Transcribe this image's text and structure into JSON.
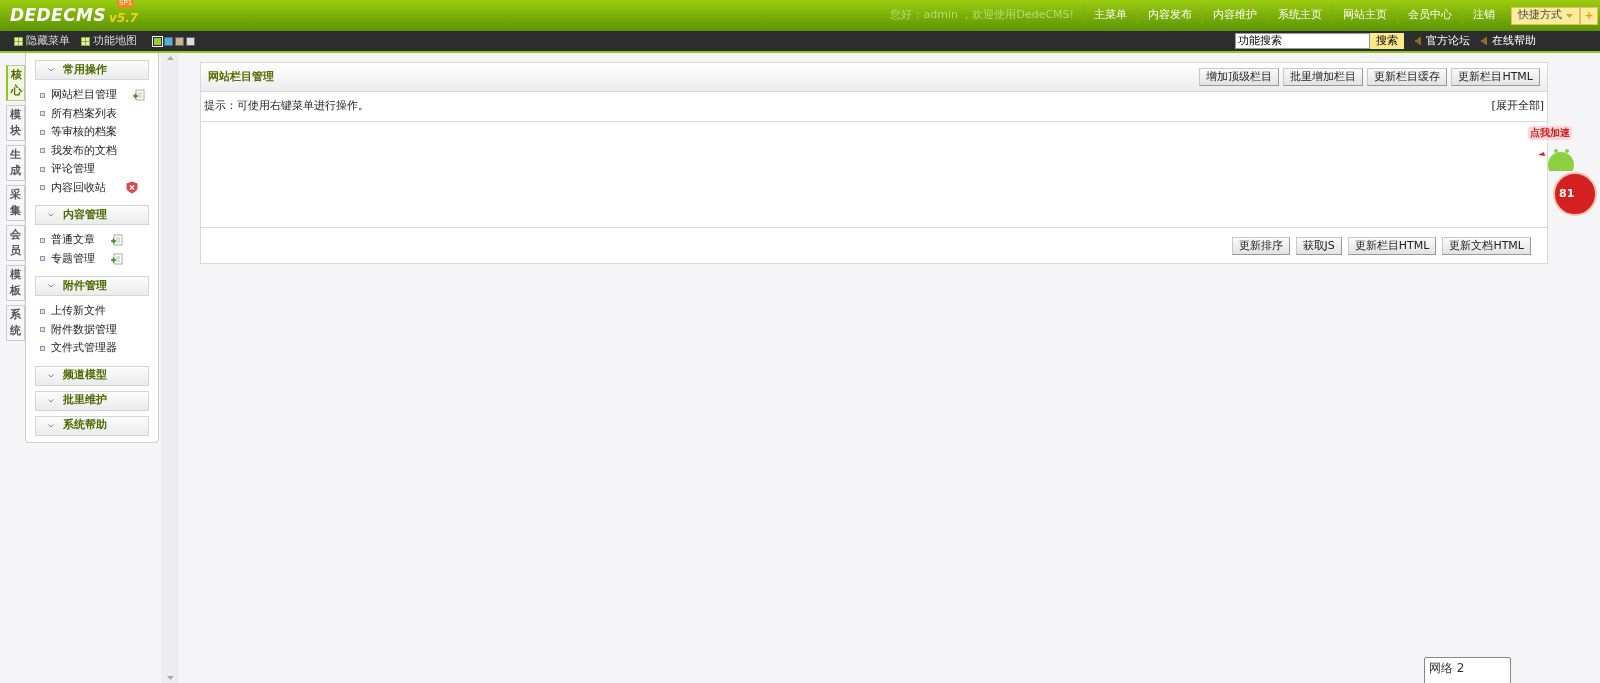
{
  "logo": {
    "name": "DEDECMS",
    "version": "v5.7",
    "badge": "SP1"
  },
  "header": {
    "greeting": "您好：admin ，欢迎使用DedeCMS!",
    "nav": [
      "主菜单",
      "内容发布",
      "内容维护",
      "系统主页",
      "网站主页",
      "会员中心",
      "注销"
    ],
    "shortcut": "快捷方式",
    "shortcut_add": "+"
  },
  "toolbar": {
    "left": [
      "隐藏菜单",
      "功能地图"
    ],
    "skins": [
      {
        "color": "#9acd32",
        "selected": true
      },
      {
        "color": "#4fb3e0",
        "selected": false
      },
      {
        "color": "#c8b48a",
        "selected": false
      },
      {
        "color": "#dddddd",
        "selected": false
      }
    ],
    "search": {
      "value": "功能搜索",
      "button": "搜索"
    },
    "links": [
      "官方论坛",
      "在线帮助"
    ]
  },
  "side_tabs": [
    {
      "label": "核心",
      "selected": true
    },
    {
      "label": "模块",
      "selected": false
    },
    {
      "label": "生成",
      "selected": false
    },
    {
      "label": "采集",
      "selected": false
    },
    {
      "label": "会员",
      "selected": false
    },
    {
      "label": "模板",
      "selected": false
    },
    {
      "label": "系统",
      "selected": false
    }
  ],
  "menu": [
    {
      "title": "常用操作",
      "items": [
        {
          "label": "网站栏目管理",
          "kind": "add"
        },
        {
          "label": "所有档案列表"
        },
        {
          "label": "等审核的档案"
        },
        {
          "label": "我发布的文档"
        },
        {
          "label": "评论管理"
        },
        {
          "label": "内容回收站",
          "kind": "remove"
        }
      ]
    },
    {
      "title": "内容管理",
      "items": [
        {
          "label": "普通文章",
          "kind": "add"
        },
        {
          "label": "专题管理",
          "kind": "add"
        }
      ]
    },
    {
      "title": "附件管理",
      "items": [
        {
          "label": "上传新文件"
        },
        {
          "label": "附件数据管理"
        },
        {
          "label": "文件式管理器"
        }
      ]
    },
    {
      "title": "频道模型"
    },
    {
      "title": "批里维护"
    },
    {
      "title": "系统帮助"
    }
  ],
  "panel": {
    "title": "网站栏目管理",
    "top_buttons": [
      "增加顶级栏目",
      "批里增加栏目",
      "更新栏目缓存",
      "更新栏目HTML"
    ],
    "hint": "提示：可使用右键菜单进行操作。",
    "expand_all": "[展开全部]",
    "bottom_buttons": [
      "更新排序",
      "获取JS",
      "更新栏目HTML",
      "更新文档HTML"
    ]
  },
  "speed_widget": {
    "label": "点我加速",
    "count": "81"
  },
  "tooltip": "网络 2"
}
